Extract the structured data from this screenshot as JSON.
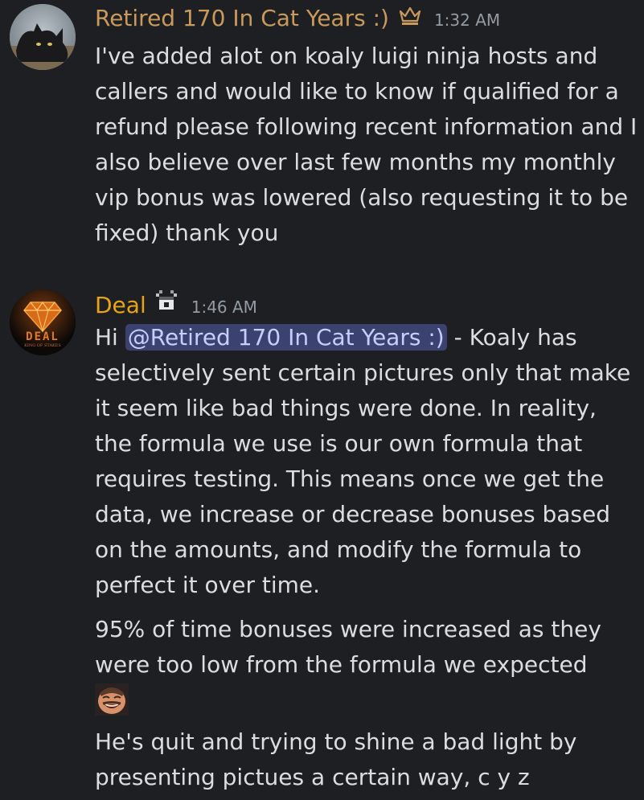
{
  "messages": [
    {
      "username": "Retired 170 In Cat Years :)",
      "username_color": "#c99a5b",
      "badge_icon": "crown-icon",
      "timestamp": "1:32 AM",
      "paragraphs": [
        "I've added alot on koaly luigi ninja hosts and callers and would like to know if qualified for a refund please following recent information and I also believe over last few months my monthly vip bonus was lowered (also requesting it to be fixed) thank you"
      ]
    },
    {
      "username": "Deal",
      "username_color": "#e8a418",
      "badge_icon": "pixel-trophy-icon",
      "timestamp": "1:46 AM",
      "avatar_text": "DEAL",
      "avatar_subtext": "KING OF STAKES",
      "greeting": "Hi",
      "mention": "@Retired 170 In Cat Years :)",
      "first_paragraph_rest": " - Koaly has selectively sent certain pictures only that make it seem like bad things were done. In reality, the formula we use is our own formula that requires testing. This means once we get the data, we increase or decrease bonuses based on the amounts, and modify the formula to perfect it over time.",
      "second_paragraph": "95% of time bonuses were increased as they were too low from the formula we expected",
      "emoji": "laughing-face-emoji",
      "third_paragraph": "He's quit and trying to shine a bad light by presenting pictues a certain way, c y z"
    }
  ]
}
